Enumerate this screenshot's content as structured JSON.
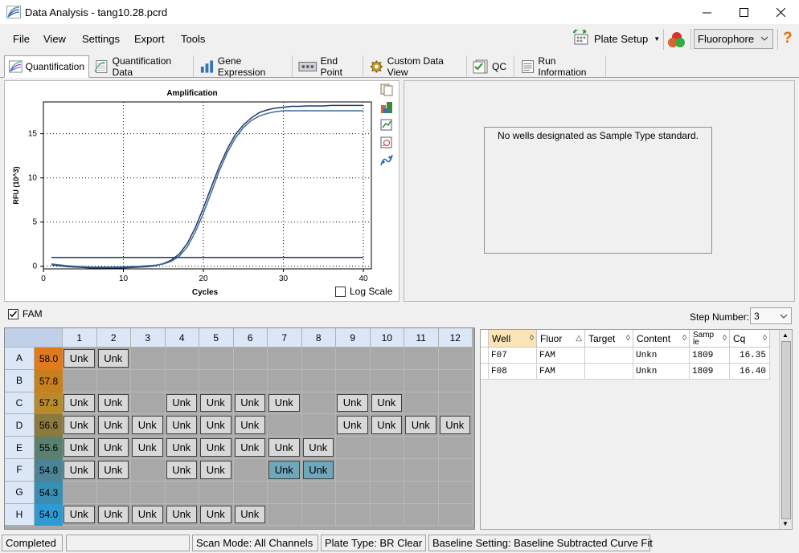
{
  "window": {
    "title": "Data Analysis - tang10.28.pcrd"
  },
  "menu": {
    "file": "File",
    "view": "View",
    "settings": "Settings",
    "export": "Export",
    "tools": "Tools"
  },
  "toolbar": {
    "plate_setup": "Plate Setup",
    "fluorophore": "Fluorophore"
  },
  "tabs": [
    {
      "label": "Quantification",
      "icon": "amplification-icon"
    },
    {
      "label": "Quantification Data",
      "icon": "data-sheet-icon"
    },
    {
      "label": "Gene Expression",
      "icon": "bar-chart-icon"
    },
    {
      "label": "End Point",
      "icon": "endpoint-icon"
    },
    {
      "label": "Custom Data View",
      "icon": "gear-icon"
    },
    {
      "label": "QC",
      "icon": "checklist-icon"
    },
    {
      "label": "Run Information",
      "icon": "document-icon"
    }
  ],
  "chart_data": {
    "type": "line",
    "title": "Amplification",
    "xlabel": "Cycles",
    "ylabel": "RFU (10^3)",
    "xlim": [
      0,
      41
    ],
    "ylim": [
      -0.3,
      18.6
    ],
    "xticks": [
      0,
      10,
      20,
      30,
      40
    ],
    "yticks": [
      0,
      5,
      10,
      15
    ],
    "grid": true,
    "log_scale_label": "Log Scale",
    "log_scale": false,
    "series": [
      {
        "x": [
          1,
          2,
          3,
          4,
          5,
          6,
          7,
          8,
          9,
          10,
          11,
          12,
          13,
          14,
          15,
          16,
          17,
          18,
          19,
          20,
          21,
          22,
          23,
          24,
          25,
          26,
          27,
          28,
          29,
          30,
          31,
          32,
          33,
          34,
          35,
          36,
          37,
          38,
          39,
          40
        ],
        "values": [
          0.15,
          0.05,
          -0.05,
          -0.1,
          -0.15,
          -0.2,
          -0.22,
          -0.22,
          -0.2,
          -0.18,
          -0.15,
          -0.1,
          -0.05,
          0.05,
          0.3,
          0.7,
          1.4,
          2.6,
          4.4,
          6.6,
          9.0,
          11.3,
          13.3,
          14.9,
          16.0,
          16.8,
          17.4,
          17.7,
          17.9,
          18.0,
          18.1,
          18.1,
          18.15,
          18.15,
          18.15,
          18.2,
          18.2,
          18.2,
          18.2,
          18.2
        ],
        "color": "#1f3a68"
      },
      {
        "x": [
          1,
          2,
          3,
          4,
          5,
          6,
          7,
          8,
          9,
          10,
          11,
          12,
          13,
          14,
          15,
          16,
          17,
          18,
          19,
          20,
          21,
          22,
          23,
          24,
          25,
          26,
          27,
          28,
          29,
          30,
          31,
          32,
          33,
          34,
          35,
          36,
          37,
          38,
          39,
          40
        ],
        "values": [
          0.25,
          0.15,
          0.05,
          0.0,
          -0.05,
          -0.08,
          -0.1,
          -0.1,
          -0.08,
          -0.06,
          -0.03,
          0.0,
          0.05,
          0.12,
          0.25,
          0.55,
          1.15,
          2.2,
          3.9,
          6.0,
          8.4,
          10.8,
          12.9,
          14.5,
          15.7,
          16.5,
          17.0,
          17.3,
          17.5,
          17.6,
          17.6,
          17.6,
          17.6,
          17.6,
          17.6,
          17.6,
          17.6,
          17.6,
          17.6,
          17.6
        ],
        "color": "#3e6c9c"
      },
      {
        "x": [
          1,
          40
        ],
        "values": [
          1.0,
          1.0
        ],
        "color": "#1f3a68"
      }
    ]
  },
  "standards_msg": "No wells designated as Sample Type standard.",
  "fam": {
    "label": "FAM",
    "checked": true
  },
  "step": {
    "label": "Step Number:",
    "value": "3"
  },
  "plate": {
    "cols": [
      "1",
      "2",
      "3",
      "4",
      "5",
      "6",
      "7",
      "8",
      "9",
      "10",
      "11",
      "12"
    ],
    "rows": [
      {
        "id": "A",
        "temp": "58.0",
        "color": "#e07a1c",
        "cells": [
          "Unk",
          "Unk",
          "",
          "",
          "",
          "",
          "",
          "",
          "",
          "",
          "",
          ""
        ]
      },
      {
        "id": "B",
        "temp": "57.8",
        "color": "#c8801e",
        "cells": [
          "",
          "",
          "",
          "",
          "",
          "",
          "",
          "",
          "",
          "",
          "",
          ""
        ]
      },
      {
        "id": "C",
        "temp": "57.3",
        "color": "#b88a2c",
        "cells": [
          "Unk",
          "Unk",
          "",
          "Unk",
          "Unk",
          "Unk",
          "Unk",
          "",
          "Unk",
          "Unk",
          "",
          ""
        ]
      },
      {
        "id": "D",
        "temp": "56.6",
        "color": "#8a7a40",
        "cells": [
          "Unk",
          "Unk",
          "Unk",
          "Unk",
          "Unk",
          "Unk",
          "",
          "",
          "Unk",
          "Unk",
          "Unk",
          "Unk"
        ]
      },
      {
        "id": "E",
        "temp": "55.6",
        "color": "#5a8070",
        "cells": [
          "Unk",
          "Unk",
          "Unk",
          "Unk",
          "Unk",
          "Unk",
          "Unk",
          "Unk",
          "",
          "",
          "",
          ""
        ]
      },
      {
        "id": "F",
        "temp": "54.8",
        "color": "#4a8496",
        "cells": [
          "Unk",
          "Unk",
          "",
          "Unk",
          "Unk",
          "",
          "Unk",
          "Unk",
          "",
          "",
          "",
          ""
        ],
        "selected": [
          6,
          7
        ]
      },
      {
        "id": "G",
        "temp": "54.3",
        "color": "#3a8eb2",
        "cells": [
          "",
          "",
          "",
          "",
          "",
          "",
          "",
          "",
          "",
          "",
          "",
          ""
        ]
      },
      {
        "id": "H",
        "temp": "54.0",
        "color": "#2e9ad4",
        "cells": [
          "Unk",
          "Unk",
          "Unk",
          "Unk",
          "Unk",
          "Unk",
          "",
          "",
          "",
          "",
          "",
          ""
        ]
      }
    ]
  },
  "results": {
    "headers": [
      "Well",
      "Fluor",
      "Target",
      "Content",
      "Samp le",
      "Cq"
    ],
    "rows": [
      [
        "F07",
        "FAM",
        "",
        "Unkn",
        "1809",
        "16.35"
      ],
      [
        "F08",
        "FAM",
        "",
        "Unkn",
        "1809",
        "16.40"
      ]
    ]
  },
  "status": {
    "state": "Completed",
    "scan_mode": "Scan Mode: All Channels",
    "plate_type": "Plate Type: BR Clear",
    "baseline": "Baseline Setting: Baseline Subtracted Curve Fit"
  }
}
